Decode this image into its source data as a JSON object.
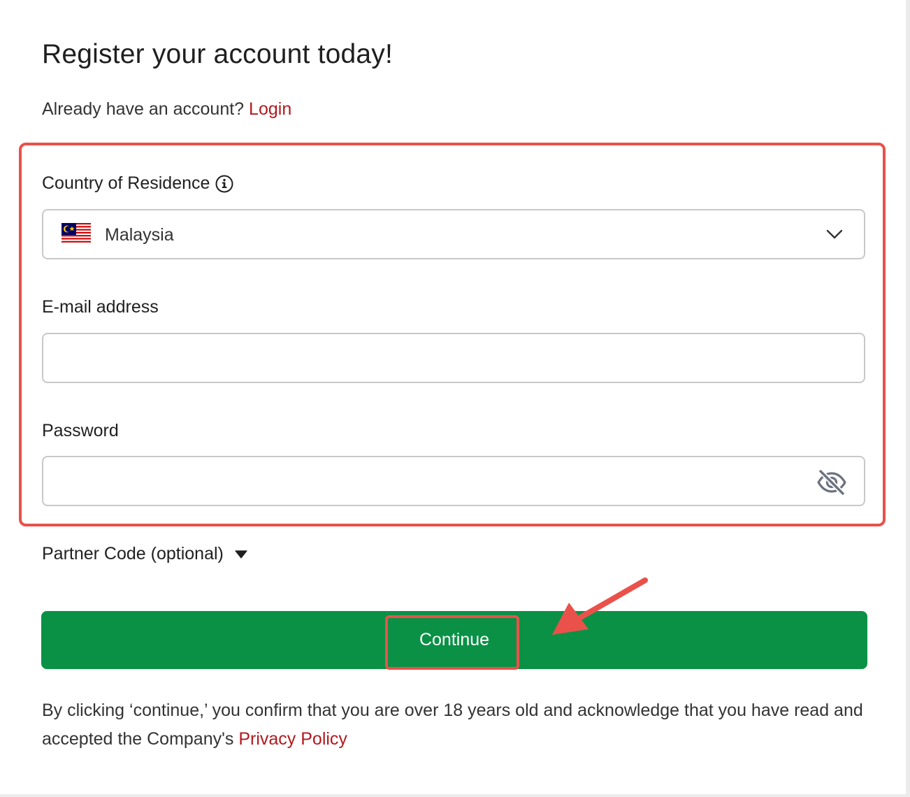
{
  "header": {
    "title": "Register your account today!",
    "subtitle_prefix": "Already have an account?",
    "login_link": "Login"
  },
  "form": {
    "country": {
      "label": "Country of Residence",
      "value": "Malaysia",
      "flag_icon": "malaysia-flag-icon",
      "info_icon": "info-icon",
      "dropdown_icon": "chevron-down-icon"
    },
    "email": {
      "label": "E-mail address",
      "value": ""
    },
    "password": {
      "label": "Password",
      "value": "",
      "toggle_icon": "eye-slash-icon"
    },
    "partner_code": {
      "label": "Partner Code (optional)",
      "toggle_icon": "caret-down-icon"
    },
    "continue_label": "Continue"
  },
  "footer": {
    "disclaimer_text": "By clicking ‘continue,’ you confirm that you are over 18 years old and acknowledge that you have read and accepted the Company's",
    "privacy_link": "Privacy Policy"
  },
  "annotations": {
    "highlight_color": "#e9514a",
    "arrow_color": "#e9514a"
  },
  "colors": {
    "link": "#b3191d",
    "primary_button": "#0a9146",
    "field_border": "#c8c8c8"
  }
}
